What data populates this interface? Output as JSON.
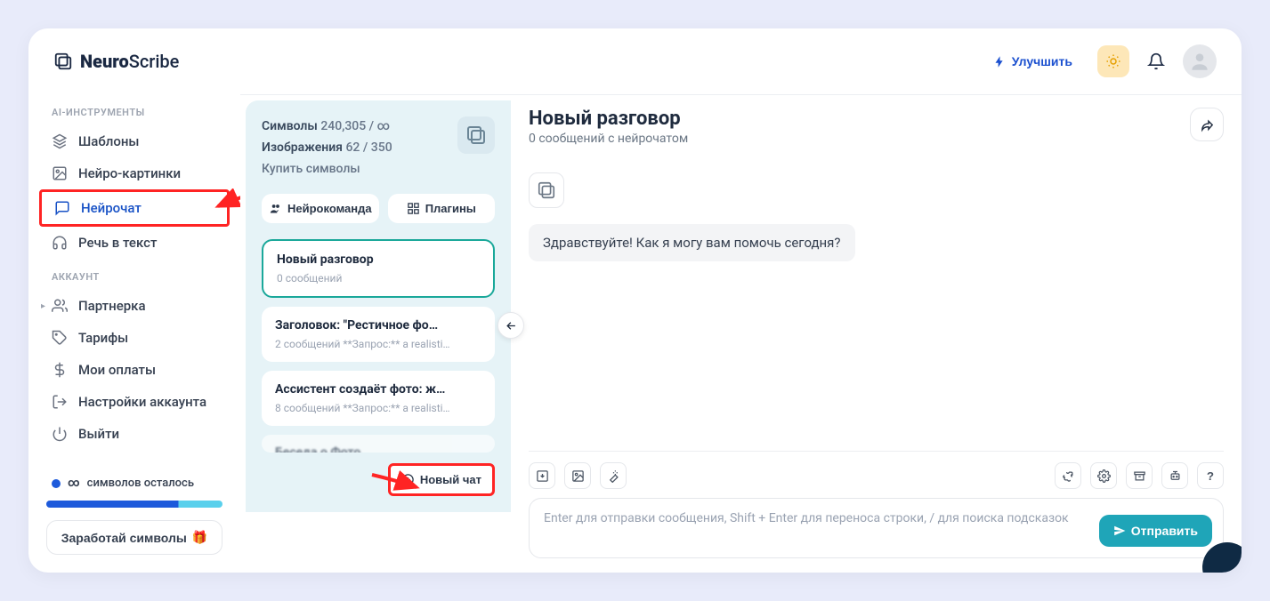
{
  "brand": {
    "name_bold": "Neuro",
    "name_light": "Scribe"
  },
  "header": {
    "upgrade_label": "Улучшить"
  },
  "sidebar": {
    "section_tools": "AI-ИНСТРУМЕНТЫ",
    "section_account": "АККАУНТ",
    "items_tools": [
      {
        "label": "Шаблоны"
      },
      {
        "label": "Нейро-картинки"
      },
      {
        "label": "Нейрочат"
      },
      {
        "label": "Речь в текст"
      }
    ],
    "items_account": [
      {
        "label": "Партнерка"
      },
      {
        "label": "Тарифы"
      },
      {
        "label": "Мои оплаты"
      },
      {
        "label": "Настройки аккаунта"
      },
      {
        "label": "Выйти"
      }
    ],
    "remaining_label": "символов осталось",
    "infinity": "∞",
    "earn_label": "Заработай символы",
    "gift": "🎁"
  },
  "chatlist": {
    "symbols_label": "Символы",
    "symbols_value": "240,305 / ∞",
    "images_label": "Изображения",
    "images_value": "62 / 350",
    "buy_label": "Купить символы",
    "tab_team": "Нейрокоманда",
    "tab_plugins": "Плагины",
    "new_chat_label": "Новый чат",
    "chats": [
      {
        "title": "Новый разговор",
        "sub": "0 сообщений"
      },
      {
        "title": "Заголовок: \"Рестичное фо…",
        "sub": "2 сообщений   **Запрос:** a realisti…"
      },
      {
        "title": "Ассистент создаёт фото: ж…",
        "sub": "8 сообщений   **Запрос:** a realisti…"
      }
    ]
  },
  "chat": {
    "title": "Новый разговор",
    "subtitle": "0 сообщений с нейрочатом",
    "greeting": "Здравствуйте! Как я могу вам помочь сегодня?",
    "placeholder": "Enter для отправки сообщения, Shift + Enter для переноса строки, / для поиска подсказок",
    "send_label": "Отправить",
    "help_label": "?"
  }
}
